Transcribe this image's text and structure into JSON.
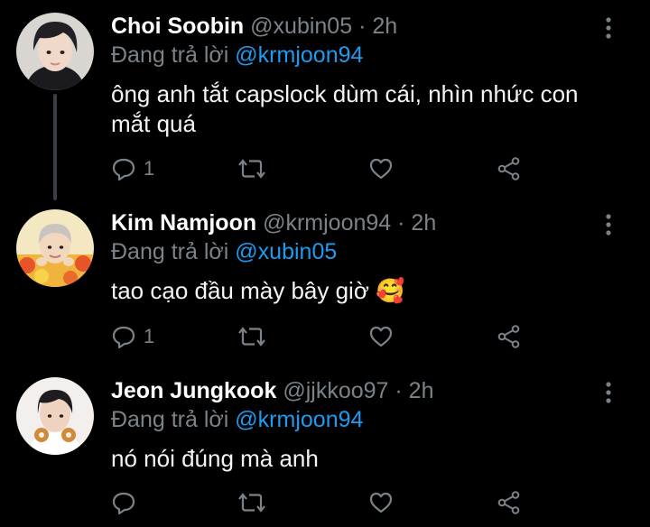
{
  "tweets": [
    {
      "name": "Choi Soobin",
      "handle": "@xubin05",
      "dot": "·",
      "time": "2h",
      "replying_prefix": "Đang trả lời",
      "replying_to": "@krmjoon94",
      "text": "ông anh tắt capslock dùm cái, nhìn nhức con mắt quá",
      "reply_count": "1"
    },
    {
      "name": "Kim Namjoon",
      "handle": "@krmjoon94",
      "dot": "·",
      "time": "2h",
      "replying_prefix": "Đang trả lời",
      "replying_to": "@xubin05",
      "text": "tao cạo đầu mày bây giờ 🥰",
      "reply_count": "1"
    },
    {
      "name": "Jeon Jungkook",
      "handle": "@jjkkoo97",
      "dot": "·",
      "time": "2h",
      "replying_prefix": "Đang trả lời",
      "replying_to": "@krmjoon94",
      "text": "nó nói đúng mà anh",
      "reply_count": ""
    }
  ],
  "icons": {
    "reply": "reply-icon",
    "retweet": "retweet-icon",
    "like": "like-icon",
    "share": "share-icon",
    "more": "more-icon"
  },
  "colors": {
    "background": "#000000",
    "secondary_text": "#7b8389",
    "mention": "#1d9bf0",
    "thread_line": "#3a3f44"
  }
}
